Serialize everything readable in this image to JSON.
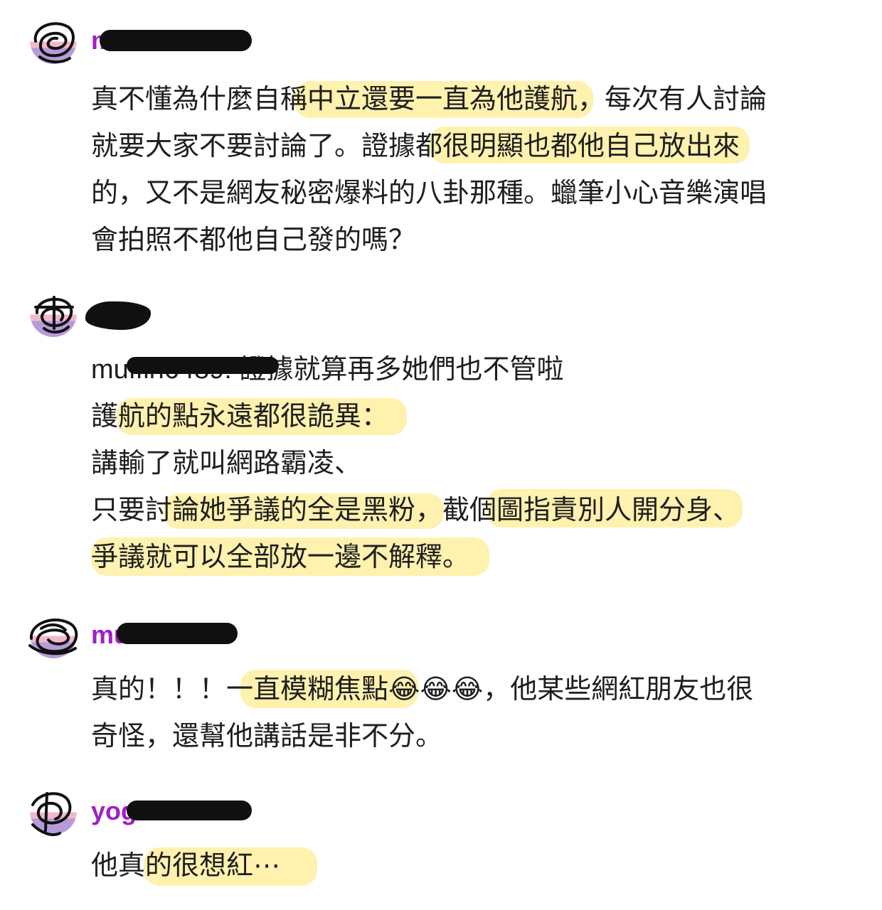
{
  "comments": [
    {
      "username": "muffin6489",
      "lines": [
        "真不懂為什麼自稱中立還要一直為他護航，每次有人討論",
        "就要大家不要討論了。證據都很明顯也都他自己放出來",
        "的，又不是網友秘密爆料的八卦那種。蠟筆小心音樂演唱",
        "會拍照不都他自己發的嗎？"
      ]
    },
    {
      "username": "",
      "lines": [
        "muffin6489: 證據就算再多她們也不管啦",
        "護航的點永遠都很詭異：",
        "講輸了就叫網路霸凌、",
        "只要討論她爭議的全是黑粉，截個圖指責別人開分身、",
        "爭議就可以全部放一邊不解釋。"
      ]
    },
    {
      "username": "muffin6489",
      "lines": [
        "真的！！！一直模糊焦點😂😂😂，他某些網紅朋友也很",
        "奇怪，還幫他講話是非不分。"
      ]
    },
    {
      "username": "yogurt0128",
      "lines": [
        "他真的很想紅⋯"
      ]
    }
  ],
  "colors": {
    "username": "#a01fc4",
    "highlight": "#ffe878",
    "text": "#1e1e1e"
  }
}
